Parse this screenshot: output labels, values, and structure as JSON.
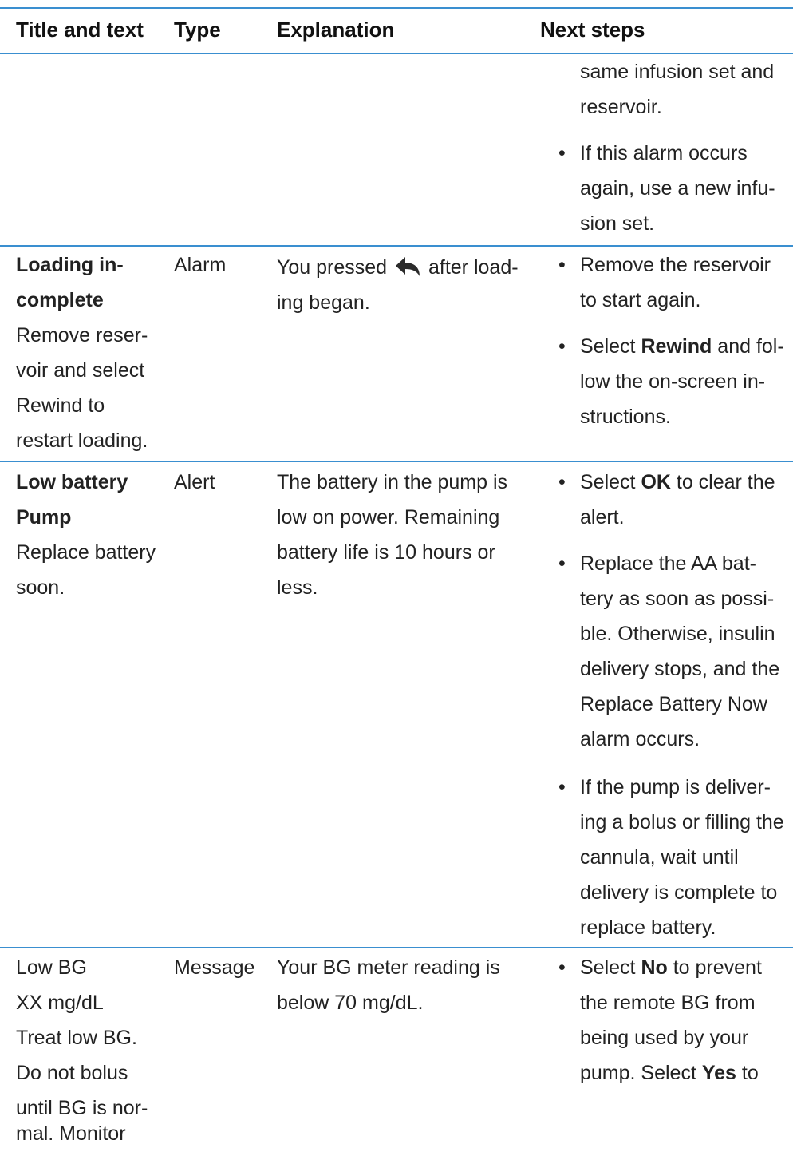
{
  "header": {
    "col1": "Title and text",
    "col2": "Type",
    "col3": "Explanation",
    "col4": "Next steps"
  },
  "row0": {
    "steps": [
      "same infusion set and reservoir.",
      "If this alarm occurs again, use a new infu-sion set."
    ]
  },
  "row1": {
    "title_bold_1": "Loading in-",
    "title_bold_2": "complete",
    "text_1": "Remove reser-",
    "text_2": "voir and select",
    "text_3": "Rewind to",
    "text_4": "restart loading.",
    "type": "Alarm",
    "expl_1a": "You pressed",
    "expl_1b": "after load-",
    "expl_2": "ing began.",
    "icon": "back-arrow-icon",
    "step1": "Remove the reservoir to start again.",
    "step2_pre": "Select ",
    "step2_bold": "Rewind",
    "step2_post": " and fol-low the on-screen in-structions."
  },
  "row2": {
    "title_bold_1": "Low battery",
    "title_bold_2": "Pump",
    "text_1": "Replace battery",
    "text_2": "soon.",
    "type": "Alert",
    "expl": "The battery in the pump is low on power. Remaining battery life is 10 hours or less.",
    "step1_pre": "Select ",
    "step1_bold": "OK",
    "step1_post": " to clear the alert.",
    "step2": "Replace the AA bat-tery as soon as possi-ble. Otherwise, insulin delivery stops, and the Replace Battery Now alarm occurs.",
    "step3": "If the pump is deliver-ing a bolus or filling the cannula, wait until delivery is complete to replace battery."
  },
  "row3": {
    "text_1": "Low BG",
    "text_2": "XX mg/dL",
    "text_3": "Treat low BG.",
    "text_4": "Do not bolus",
    "text_5": "until BG is nor-",
    "text_6": "mal. Monitor",
    "type": "Message",
    "expl": "Your BG meter reading is below 70 mg/dL.",
    "step1_pre": "Select ",
    "step1_bold": "No",
    "step1_mid": " to prevent the remote BG from being used by your pump. Select ",
    "step1_bold2": "Yes",
    "step1_post": " to"
  },
  "colors": {
    "rule": "#3a8fd0",
    "text": "#222222"
  }
}
